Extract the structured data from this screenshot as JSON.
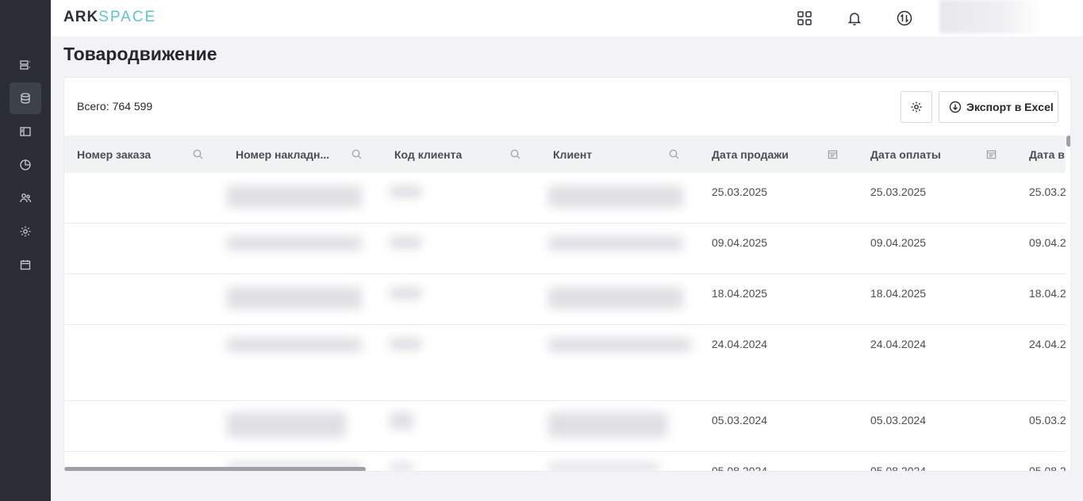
{
  "app": {
    "logo_ark": "ARK",
    "logo_space": "SPACE"
  },
  "sidebar": {
    "items": [
      {
        "name": "sidebar-item-list",
        "icon": "list-icon",
        "active": false
      },
      {
        "name": "sidebar-item-database",
        "icon": "database-icon",
        "active": true
      },
      {
        "name": "sidebar-item-layout",
        "icon": "layout-icon",
        "active": false
      },
      {
        "name": "sidebar-item-chart",
        "icon": "pie-chart-icon",
        "active": false
      },
      {
        "name": "sidebar-item-users",
        "icon": "users-icon",
        "active": false
      },
      {
        "name": "sidebar-item-settings",
        "icon": "gear-icon",
        "active": false
      },
      {
        "name": "sidebar-item-calendar",
        "icon": "calendar-icon",
        "active": false
      }
    ]
  },
  "header": {
    "icons": [
      "apps-grid-icon",
      "bell-icon",
      "exchange-icon"
    ]
  },
  "page": {
    "title": "Товародвижение",
    "total_label": "Всего:",
    "total_value": "764 599",
    "export_label": "Экспорт в Excel"
  },
  "table": {
    "columns": [
      {
        "label": "Номер заказа",
        "icon": "search-icon"
      },
      {
        "label": "Номер накладн...",
        "icon": "search-icon"
      },
      {
        "label": "Код клиента",
        "icon": "search-icon"
      },
      {
        "label": "Клиент",
        "icon": "search-icon"
      },
      {
        "label": "Дата продажи",
        "icon": "calendar-icon"
      },
      {
        "label": "Дата оплаты",
        "icon": "calendar-icon"
      },
      {
        "label": "Дата в",
        "icon": ""
      }
    ],
    "rows": [
      {
        "sale_date": "25.03.2025",
        "pay_date": "25.03.2025",
        "other_date": "25.03.2"
      },
      {
        "sale_date": "09.04.2025",
        "pay_date": "09.04.2025",
        "other_date": "09.04.2"
      },
      {
        "sale_date": "18.04.2025",
        "pay_date": "18.04.2025",
        "other_date": "18.04.2"
      },
      {
        "sale_date": "24.04.2024",
        "pay_date": "24.04.2024",
        "other_date": "24.04.2"
      },
      {
        "sale_date": "05.03.2024",
        "pay_date": "05.03.2024",
        "other_date": "05.03.2"
      },
      {
        "sale_date": "05.08.2024",
        "pay_date": "05.08.2024",
        "other_date": "05.08.2"
      }
    ]
  }
}
